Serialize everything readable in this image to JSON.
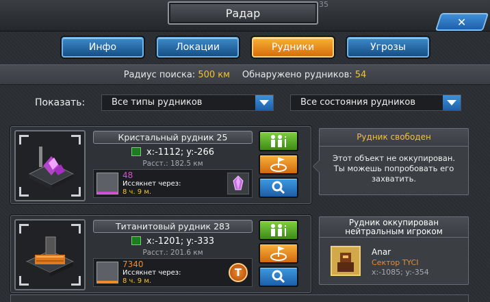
{
  "window": {
    "title": "Радар",
    "corner_number": "35",
    "close_label": "✕"
  },
  "tabs": [
    {
      "label": "Инфо",
      "active": false
    },
    {
      "label": "Локации",
      "active": false
    },
    {
      "label": "Рудники",
      "active": true
    },
    {
      "label": "Угрозы",
      "active": false
    }
  ],
  "info": {
    "radius_label": "Радиус поиска:",
    "radius_value": "500 км",
    "found_label": "Обнаружено рудников:",
    "found_value": "54"
  },
  "filters": {
    "show_label": "Показать:",
    "type_select": "Все типы рудников",
    "state_select": "Все состояния рудников"
  },
  "mines": [
    {
      "name": "Кристальный рудник 25",
      "coords": "x:-1112; y:-266",
      "distance": "Расст.: 182.5 км",
      "amount": "48",
      "amount_color": "#d94fd0",
      "depletes_label": "Иссякнет через:",
      "depletes_time": "8 ч. 9 м.",
      "resource_icon": "crystal-icon",
      "status_title": "Рудник свободен",
      "status_text": "Этот объект не оккупирован. Ты можешь попробовать его захватить."
    },
    {
      "name": "Титанитовый рудник 283",
      "coords": "x:-1201; y:-333",
      "distance": "Расст.: 201.6 км",
      "amount": "7340",
      "amount_color": "#f08a2a",
      "depletes_label": "Иссякнет через:",
      "depletes_time": "8 ч. 9 м.",
      "resource_icon": "titanite-icon",
      "resource_letter": "T",
      "status_title": "Рудник оккупирован нейтральным игроком",
      "owner": {
        "name": "Anar",
        "sector": "Сектор TYCI",
        "coords": "x:-1085; y:-354"
      }
    }
  ],
  "colors": {
    "accent_orange": "#f5c330",
    "tab_blue": "#164f86",
    "tab_active": "#d76d0c"
  }
}
